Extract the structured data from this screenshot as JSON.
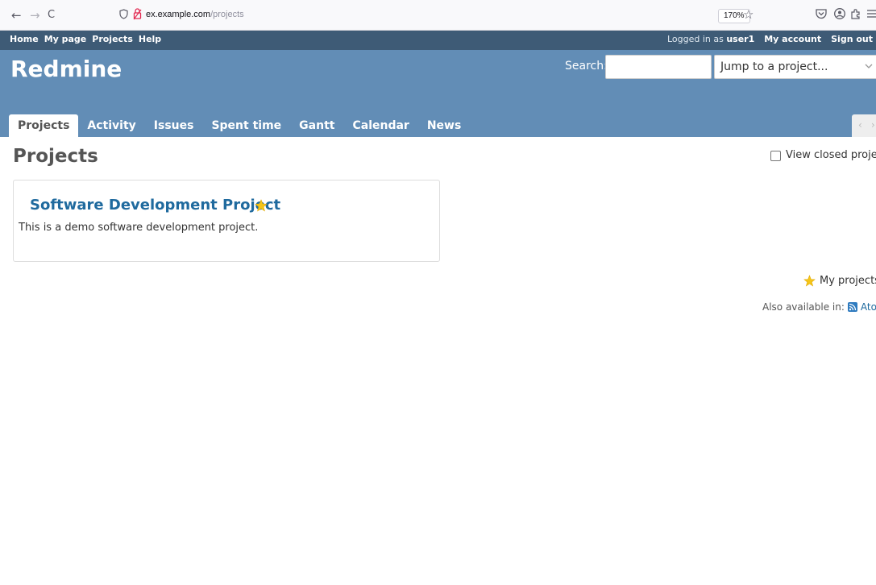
{
  "browser": {
    "back": "←",
    "forward": "→",
    "reload": "C",
    "url_host": "ex.example.com",
    "url_path": "/projects",
    "zoom": "170%"
  },
  "top_menu": {
    "items": [
      "Home",
      "My page",
      "Projects",
      "Help"
    ],
    "logged_in_prefix": "Logged in as",
    "user": "user1",
    "my_account": "My account",
    "sign_out": "Sign out"
  },
  "header": {
    "title": "Redmine",
    "search_label": "Search:",
    "search_value": "",
    "jump_placeholder": "Jump to a project..."
  },
  "tabs": [
    {
      "label": "Projects",
      "selected": true
    },
    {
      "label": "Activity",
      "selected": false
    },
    {
      "label": "Issues",
      "selected": false
    },
    {
      "label": "Spent time",
      "selected": false
    },
    {
      "label": "Gantt",
      "selected": false
    },
    {
      "label": "Calendar",
      "selected": false
    },
    {
      "label": "News",
      "selected": false
    }
  ],
  "main": {
    "title": "Projects",
    "view_closed_label": "View closed projects",
    "view_closed_checked": false,
    "project": {
      "name": "Software Development Project",
      "description": "This is a demo software development project."
    },
    "my_projects_label": "My projects",
    "also_available_label": "Also available in:",
    "atom_label": "Atom"
  },
  "colors": {
    "top_menu_bg": "#3e5b76",
    "header_bg": "#628db6",
    "link": "#1f6a9e",
    "star": "#f5c518"
  }
}
